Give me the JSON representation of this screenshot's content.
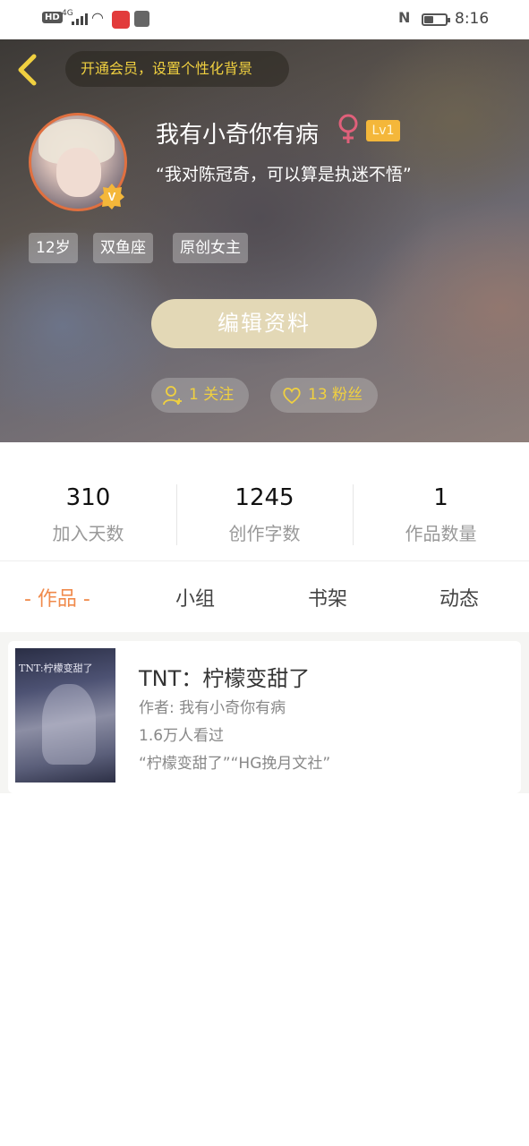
{
  "status_bar": {
    "hd": "HD",
    "network": "4G",
    "time": "8:16",
    "battery_level": 0.4
  },
  "header": {
    "vip_banner": "开通会员，设置个性化背景",
    "username": "我有小奇你有病",
    "level": "Lv1",
    "signature": "“我对陈冠奇，可以算是执迷不悟”",
    "tags": [
      "12岁",
      "双鱼座",
      "原创女主"
    ],
    "edit_button": "编辑资料",
    "following": "1 关注",
    "followers": "13 粉丝",
    "colors": {
      "accent_yellow": "#f0d040",
      "gender_pink": "#e0607a",
      "level_badge": "#f4b73a",
      "verified_badge": "#f4b73a"
    },
    "icons": {
      "back": "chevron-left-icon",
      "gender": "female-icon",
      "verified": "v-badge-icon",
      "following": "person-add-icon",
      "followers": "heart-icon"
    }
  },
  "stats": [
    {
      "value": "310",
      "label": "加入天数"
    },
    {
      "value": "1245",
      "label": "创作字数"
    },
    {
      "value": "1",
      "label": "作品数量"
    }
  ],
  "tabs": {
    "active_color": "#f08a4b",
    "items": [
      {
        "label": "- 作品 -",
        "active": true
      },
      {
        "label": "小组",
        "active": false
      },
      {
        "label": "书架",
        "active": false
      },
      {
        "label": "动态",
        "active": false
      }
    ]
  },
  "works": [
    {
      "cover_text": "TNT:柠檬变甜了",
      "title": "TNT：柠檬变甜了",
      "author": "作者: 我有小奇你有病",
      "views": "1.6万人看过",
      "tags": "“柠檬变甜了”“HG挽月文社”"
    }
  ]
}
